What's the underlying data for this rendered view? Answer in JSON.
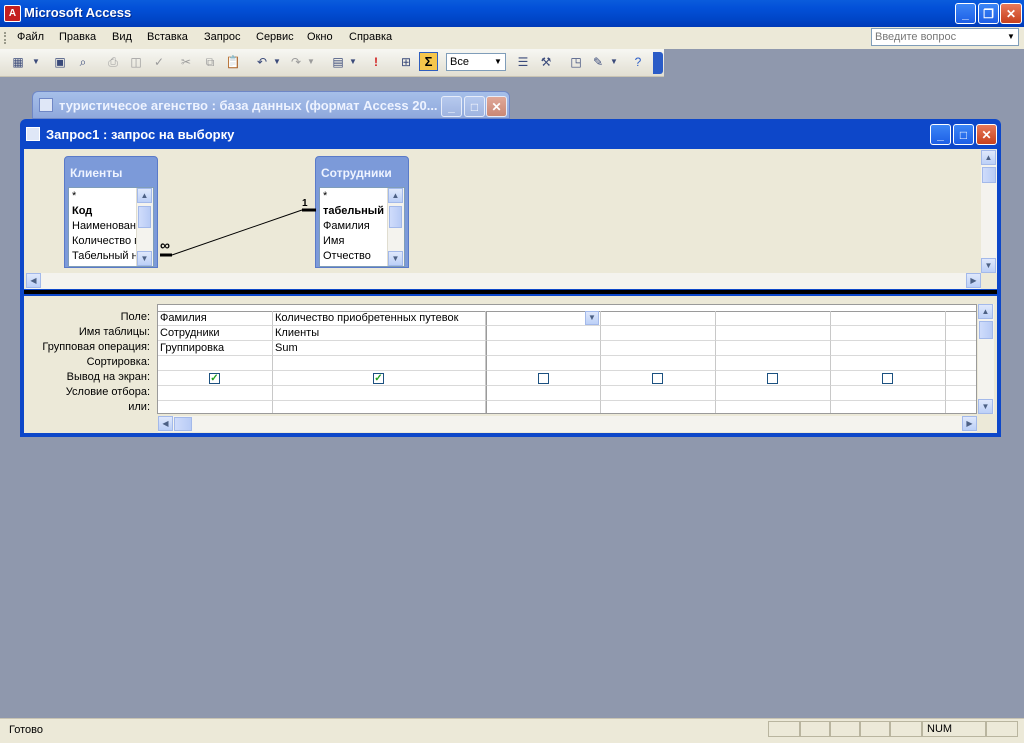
{
  "app": {
    "title": "Microsoft Access",
    "icon": "access-icon"
  },
  "menu": {
    "items": [
      "Файл",
      "Правка",
      "Вид",
      "Вставка",
      "Запрос",
      "Сервис",
      "Окно",
      "Справка"
    ],
    "help_placeholder": "Введите вопрос"
  },
  "toolbar": {
    "top_values_value": "Все"
  },
  "db_window": {
    "title": "туристичесое агенство : база данных (формат Access 20..."
  },
  "query_window": {
    "title": "Запрос1 : запрос на выборку"
  },
  "tables": [
    {
      "name": "Клиенты",
      "fields": [
        "*",
        "Код",
        "Наименовани",
        "Количество п",
        "Табельный н"
      ],
      "bold_field": 1
    },
    {
      "name": "Сотрудники",
      "fields": [
        "*",
        "табельный н",
        "Фамилия",
        "Имя",
        "Отчество"
      ],
      "bold_field": 1
    }
  ],
  "relationship": {
    "one_label": "1",
    "many_label": "∞"
  },
  "grid": {
    "row_labels": [
      "Поле:",
      "Имя таблицы:",
      "Групповая операция:",
      "Сортировка:",
      "Вывод на экран:",
      "Условие отбора:",
      "или:"
    ],
    "columns": [
      {
        "field": "Фамилия",
        "table": "Сотрудники",
        "total": "Группировка",
        "show": true
      },
      {
        "field": "Количество приобретенных путевок",
        "table": "Клиенты",
        "total": "Sum",
        "show": true
      },
      {
        "field": "",
        "table": "",
        "total": "",
        "show": false
      },
      {
        "field": "",
        "table": "",
        "total": "",
        "show": false
      },
      {
        "field": "",
        "table": "",
        "total": "",
        "show": false
      },
      {
        "field": "",
        "table": "",
        "total": "",
        "show": false
      }
    ]
  },
  "status": {
    "text": "Готово",
    "num": "NUM"
  },
  "colors": {
    "titlebar": "#0350d8",
    "desktop": "#8f98ad",
    "chrome": "#ece9d8"
  }
}
